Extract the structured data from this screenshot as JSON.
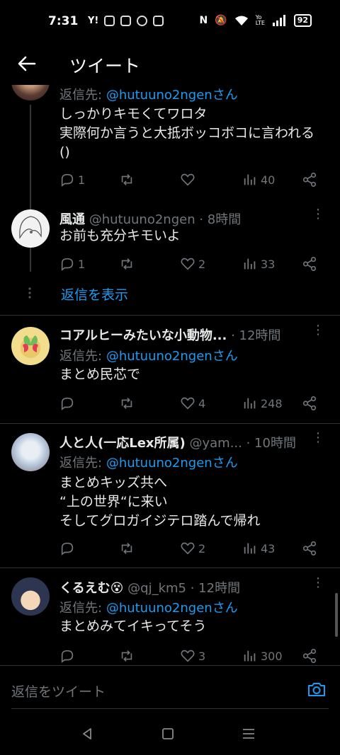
{
  "status": {
    "time": "7:31",
    "battery": "92",
    "icons": [
      "yahoo-icon",
      "line-icon",
      "instagram-icon",
      "chrome-icon",
      "store-icon",
      "nfc-icon",
      "mute-icon",
      "wifi-icon",
      "volte-icon",
      "signal-icon"
    ],
    "network_label": "Yo LTE"
  },
  "header": {
    "title": "ツイート"
  },
  "tweets": [
    {
      "replying_prefix": "返信先:",
      "replying_to": "@hutuuno2ngenさん",
      "text": "しっかりキモくてワロタ\n実際何か言うと大抵ボッコボコに言われる\n()",
      "replies": "1",
      "retweets": "",
      "likes": "",
      "views": "40"
    },
    {
      "name": "風通",
      "handle": "@hutuuno2ngen",
      "time": "· 8時間",
      "text": "お前も充分キモいよ",
      "replies": "1",
      "retweets": "",
      "likes": "2",
      "views": "33"
    },
    {
      "name": "コアルヒーみたいな小動物...",
      "handle": "",
      "time": "· 12時間",
      "replying_prefix": "返信先:",
      "replying_to": "@hutuuno2ngenさん",
      "text": "まとめ民芯で",
      "replies": "",
      "retweets": "",
      "likes": "4",
      "views": "248"
    },
    {
      "name": "人と人(一応Lex所属)",
      "handle": "@yam...",
      "time": "· 10時間",
      "replying_prefix": "返信先:",
      "replying_to": "@hutuuno2ngenさん",
      "text": "まとめキッズ共へ\n“上の世界“に来い\nそしてグロガイジテロ踏んで帰れ",
      "replies": "",
      "retweets": "",
      "likes": "2",
      "views": "43"
    },
    {
      "name": "くるえむ😵",
      "handle": "@qj_km5",
      "time": "· 12時間",
      "replying_prefix": "返信先:",
      "replying_to": "@hutuuno2ngenさん",
      "text": "まとめみてイキってそう",
      "replies": "",
      "retweets": "",
      "likes": "3",
      "views": "300"
    }
  ],
  "show_replies": "返信を表示",
  "composer": {
    "placeholder": "返信をツイート"
  },
  "colors": {
    "accent": "#1d9bf0",
    "muted": "#71767b",
    "background": "#000000"
  }
}
